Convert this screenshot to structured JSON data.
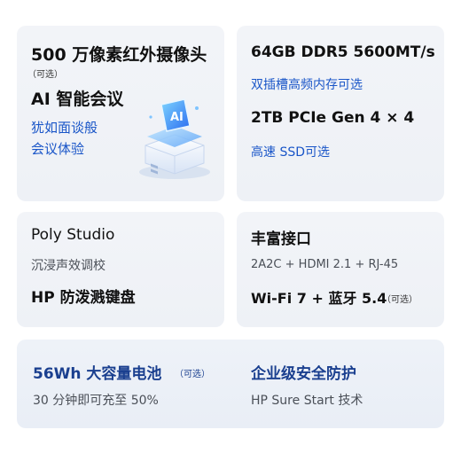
{
  "card_camera": {
    "title": "500 万像素红外摄像头",
    "optional": "（可选）",
    "ai_title": "AI 智能会议",
    "desc_line1": "犹如面谈般",
    "desc_line2": "会议体验",
    "illustration_label": "AI",
    "illustration_icon": "ai-meeting-device-icon"
  },
  "card_memory": {
    "mem_title": "64GB DDR5 5600MT/s",
    "mem_desc": "双插槽高频内存可选",
    "ssd_title": "2TB PCIe Gen 4 × 4",
    "ssd_desc": "高速 SSD可选"
  },
  "card_audio": {
    "title": "Poly Studio",
    "desc": "沉浸声效调校",
    "keyboard": "HP 防泼溅键盘"
  },
  "card_ports": {
    "title": "丰富接口",
    "desc": "2A2C + HDMI 2.1 + RJ-45",
    "wifi": "Wi-Fi 7 + 蓝牙 5.4",
    "optional": "（可选）"
  },
  "card_battery": {
    "title": "56Wh 大容量电池",
    "optional": "（可选）",
    "desc": "30 分钟即可充至 50%"
  },
  "card_security": {
    "title": "企业级安全防护",
    "desc": "HP Sure Start 技术"
  }
}
